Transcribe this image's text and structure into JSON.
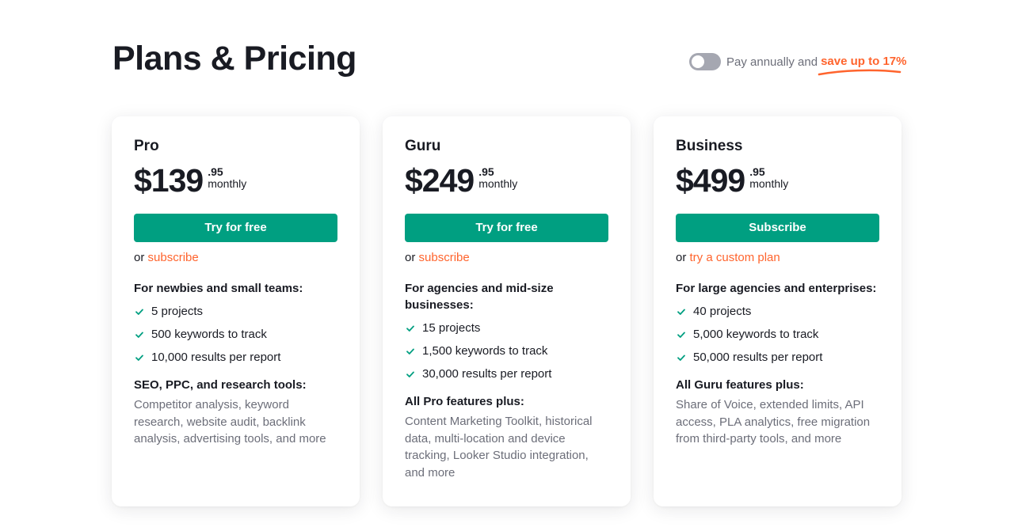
{
  "header": {
    "title": "Plans & Pricing",
    "billing_toggle": {
      "state": "off",
      "label": "Pay annually and",
      "highlight": "save up to 17%"
    }
  },
  "colors": {
    "brand_green": "#009f81",
    "accent_orange": "#ff642d",
    "text_primary": "#191b23",
    "text_secondary": "#6c6e79",
    "toggle_off": "#a5a7b1"
  },
  "plans": [
    {
      "name": "Pro",
      "price_whole": "$139",
      "price_cents": ".95",
      "period": "monthly",
      "cta_label": "Try for free",
      "alt_prefix": "or",
      "alt_link": "subscribe",
      "audience": "For newbies and small teams:",
      "features": [
        {
          "icon": "check-icon",
          "text": "5 projects"
        },
        {
          "icon": "check-icon",
          "text": "500 keywords to track"
        },
        {
          "icon": "check-icon",
          "text": "10,000 results per report"
        }
      ],
      "extras_title": "SEO, PPC, and research tools:",
      "extras_desc": "Competitor analysis, keyword research, website audit, backlink analysis, advertising tools, and more"
    },
    {
      "name": "Guru",
      "price_whole": "$249",
      "price_cents": ".95",
      "period": "monthly",
      "cta_label": "Try for free",
      "alt_prefix": "or",
      "alt_link": "subscribe",
      "audience": "For agencies and mid-size businesses:",
      "features": [
        {
          "icon": "check-icon",
          "text": "15 projects"
        },
        {
          "icon": "check-icon",
          "text": "1,500 keywords to track"
        },
        {
          "icon": "check-icon",
          "text": "30,000 results per report"
        }
      ],
      "extras_title": "All Pro features plus:",
      "extras_desc": "Content Marketing Toolkit, historical data, multi-location and device tracking, Looker Studio integration, and more"
    },
    {
      "name": "Business",
      "price_whole": "$499",
      "price_cents": ".95",
      "period": "monthly",
      "cta_label": "Subscribe",
      "alt_prefix": "or",
      "alt_link": "try a custom plan",
      "audience": "For large agencies and enterprises:",
      "features": [
        {
          "icon": "check-icon",
          "text": "40 projects"
        },
        {
          "icon": "check-icon",
          "text": "5,000 keywords to track"
        },
        {
          "icon": "check-icon",
          "text": "50,000 results per report"
        }
      ],
      "extras_title": "All Guru features plus:",
      "extras_desc": "Share of Voice, extended limits, API access, PLA analytics, free migration from third-party tools, and more"
    }
  ]
}
